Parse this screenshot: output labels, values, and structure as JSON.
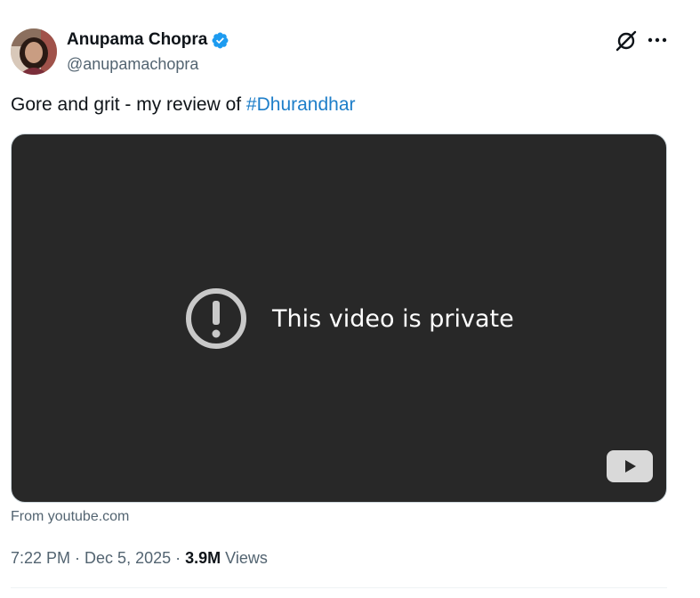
{
  "author": {
    "display_name": "Anupama Chopra",
    "handle": "@anupamachopra",
    "verified": true
  },
  "tweet": {
    "text_prefix": "Gore and grit - my review of ",
    "hashtag": "#Dhurandhar"
  },
  "embed": {
    "message": "This video is private",
    "source": "From youtube.com"
  },
  "meta": {
    "time": "7:22 PM",
    "separator": " · ",
    "date": "Dec 5, 2025",
    "views_count": "3.9M",
    "views_label": " Views"
  },
  "colors": {
    "link": "#1d7ec9",
    "verified_badge": "#1d9bf0",
    "video_bg": "#282828",
    "muted_text": "#536471"
  },
  "icons": {
    "grok": "grok-icon",
    "more": "more-icon",
    "verified": "verified-badge-icon",
    "warning": "alert-circle-icon",
    "play": "youtube-play-icon"
  }
}
